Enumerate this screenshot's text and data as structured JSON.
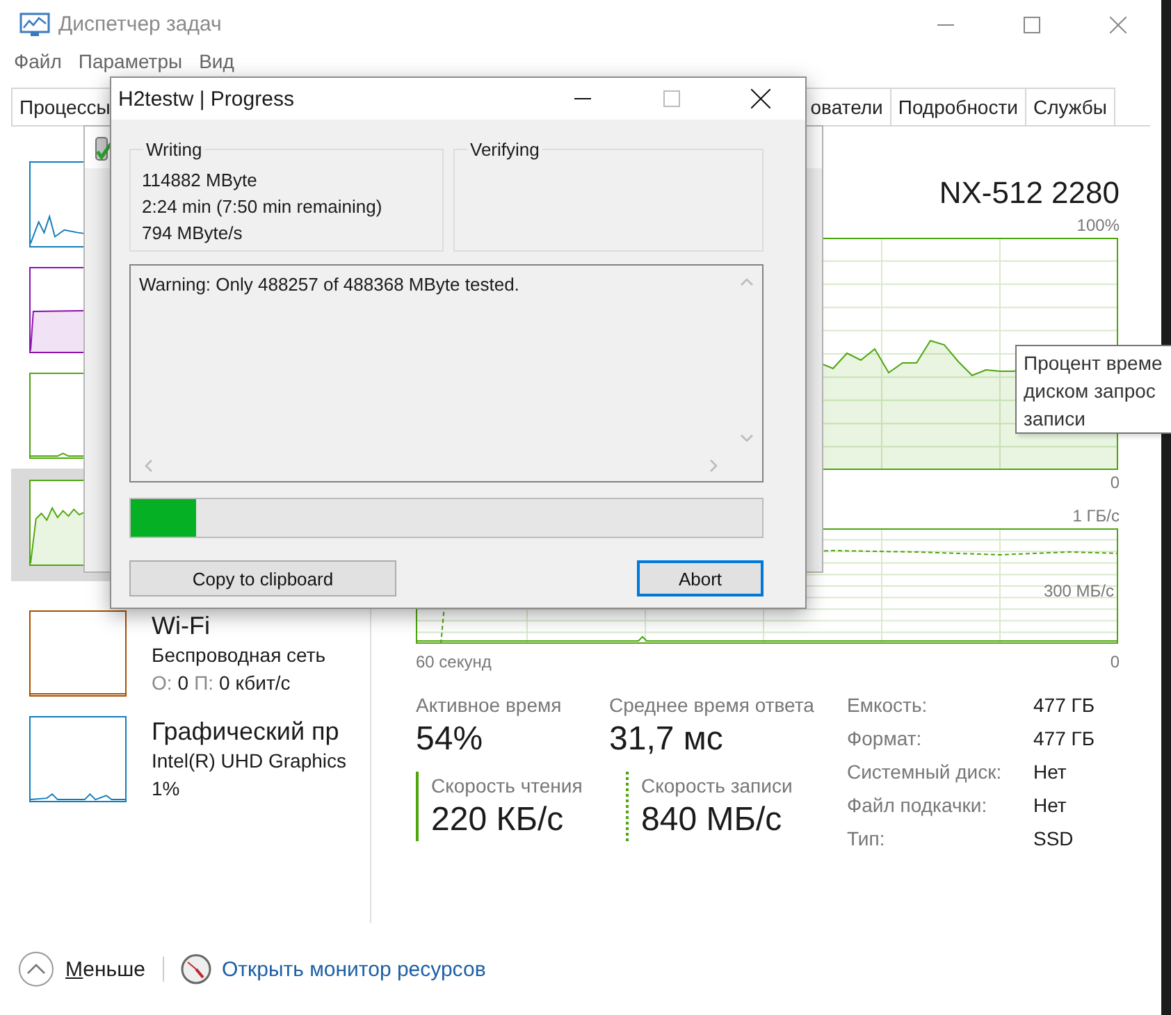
{
  "window": {
    "title": "Диспетчер задач"
  },
  "menu": [
    "Файл",
    "Параметры",
    "Вид"
  ],
  "tabs": [
    {
      "label": "Процессы",
      "selected": false
    },
    {
      "label": "ователи",
      "selected": false
    },
    {
      "label": "Подробности",
      "selected": false
    },
    {
      "label": "Службы",
      "selected": false
    }
  ],
  "sidebar_items": [
    {
      "color": "#117dbb",
      "selected": false
    },
    {
      "color": "#8b12ae",
      "selected": false
    },
    {
      "color": "#4da60c",
      "selected": false
    },
    {
      "color": "#4da60c",
      "selected": true
    },
    {
      "color": "#a74f01",
      "selected": false,
      "title": "Wi-Fi",
      "subtitle": "Беспроводная сеть",
      "detail": [
        {
          "label": "О:",
          "value": "0"
        },
        {
          "label": "П:",
          "value": "0 кбит/с"
        }
      ]
    },
    {
      "color": "#117dbb",
      "selected": false,
      "title": "Графический пр",
      "subtitle": "Intel(R) UHD Graphics",
      "detail": [
        {
          "value": "1%"
        }
      ]
    }
  ],
  "disk": {
    "name": "NX-512 2280",
    "chart1_max": "100%",
    "chart1_min": "0",
    "chart2_max": "1 ГБ/с",
    "chart2_mark": "300 МБ/с",
    "time_span": "60 секунд",
    "chart2_min": "0",
    "stats": [
      {
        "label": "Активное время",
        "value": "54%"
      },
      {
        "label": "Среднее время ответа",
        "value": "31,7 мс"
      }
    ],
    "rates": [
      {
        "label": "Скорость чтения",
        "value": "220 КБ/с",
        "kind": "solid"
      },
      {
        "label": "Скорость записи",
        "value": "840 МБ/с",
        "kind": "dotted"
      }
    ],
    "properties": [
      {
        "label": "Емкость:",
        "value": "477 ГБ"
      },
      {
        "label": "Формат:",
        "value": "477 ГБ"
      },
      {
        "label": "Системный диск:",
        "value": "Нет"
      },
      {
        "label": "Файл подкачки:",
        "value": "Нет"
      },
      {
        "label": "Тип:",
        "value": "SSD"
      }
    ]
  },
  "tooltip": [
    "Процент време",
    "диском запрос",
    "записи"
  ],
  "footer": {
    "less": "Меньше",
    "link": "Открыть монитор ресурсов"
  },
  "dialog": {
    "title": "H2testw | Progress",
    "writing": {
      "title": "Writing",
      "lines": [
        "114882 MByte",
        "2:24 min (7:50 min remaining)",
        "794 MByte/s"
      ]
    },
    "verifying": {
      "title": "Verifying"
    },
    "log": "Warning: Only 488257 of 488368 MByte tested.",
    "level": 0.103,
    "buttons": [
      {
        "label": "Copy to clipboard",
        "focused": false
      },
      {
        "label": "Abort",
        "focused": true
      }
    ]
  }
}
